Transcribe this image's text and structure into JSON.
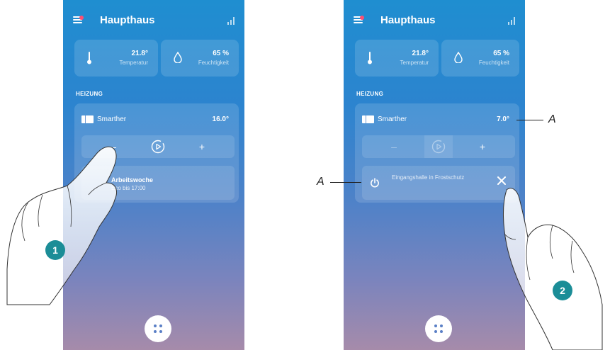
{
  "colors": {
    "accent": "#1f8ed0",
    "badge": "#1b8d97",
    "menu_dot": "#ff4f73"
  },
  "screens": [
    {
      "header": {
        "title": "Haupthaus"
      },
      "tiles": [
        {
          "value": "21.8°",
          "label": "Temperatur",
          "icon": "thermometer-icon"
        },
        {
          "value": "65 %",
          "label": "Feuchtigkeit",
          "icon": "droplet-icon"
        }
      ],
      "section_title": "HEIZUNG",
      "device": {
        "name": "Smarther",
        "temperature": "16.0°"
      },
      "controls": {
        "minus": "–",
        "plus": "+"
      },
      "program": {
        "title": "Arbeitswoche",
        "subtitle": "Eco bis 17:00"
      }
    },
    {
      "header": {
        "title": "Haupthaus"
      },
      "tiles": [
        {
          "value": "21.8°",
          "label": "Temperatur",
          "icon": "thermometer-icon"
        },
        {
          "value": "65 %",
          "label": "Feuchtigkeit",
          "icon": "droplet-icon"
        }
      ],
      "section_title": "HEIZUNG",
      "device": {
        "name": "Smarther",
        "temperature": "7.0°"
      },
      "controls": {
        "minus": "–",
        "plus": "+"
      },
      "program": {
        "text": "Eingangshalle in Frostschutz",
        "close": "✕"
      }
    }
  ],
  "annotations": {
    "step1": "1",
    "step2": "2",
    "callout_temp": "A",
    "callout_mode": "A"
  }
}
